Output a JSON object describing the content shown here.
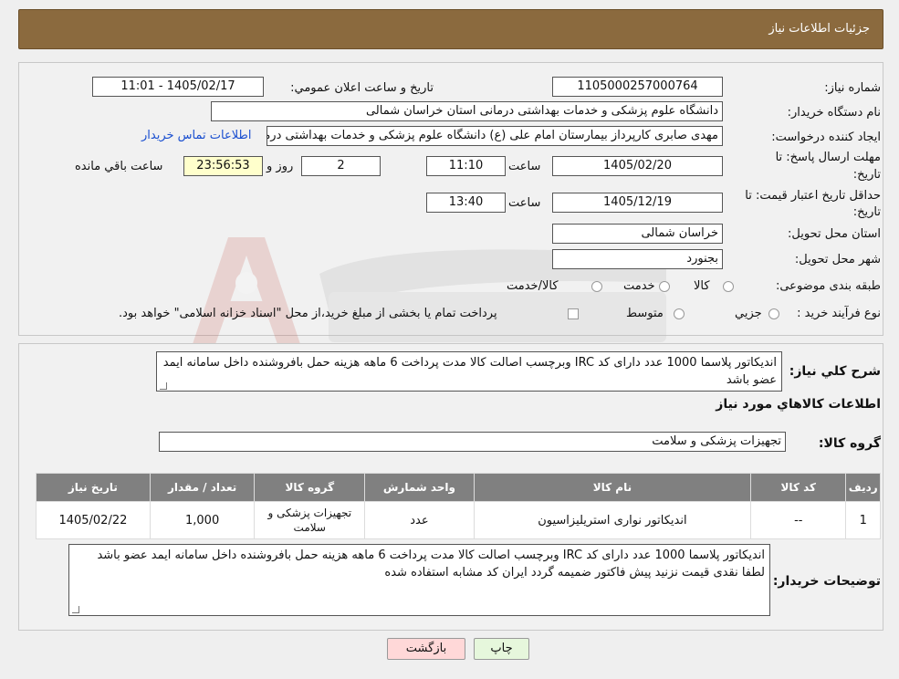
{
  "header": {
    "title": "جزئیات اطلاعات نیاز"
  },
  "info": {
    "need_number_label": "شماره نیاز:",
    "need_number": "1105000257000764",
    "announce_label": "تاریخ و ساعت اعلان عمومي:",
    "announce_value": "1405/02/17 - 11:01",
    "buyer_org_label": "نام دستگاه خريدار:",
    "buyer_org": "دانشگاه علوم پزشکی و خدمات بهداشتی درمانی استان خراسان شمالی",
    "creator_label": "ايجاد کننده درخواست:",
    "creator": "مهدی صابری کارپرداز بیمارستان امام علی (ع) دانشگاه علوم پزشکی و خدمات بهداشتی درمانی",
    "contact_link": "اطلاعات تماس خريدار",
    "deadline_label_1": "مهلت ارسال پاسخ: تا",
    "deadline_label_2": "تاريخ:",
    "deadline_date": "1405/02/20",
    "time_label": "ساعت",
    "deadline_time": "11:10",
    "days_value": "2",
    "days_label": "روز و",
    "remaining_value": "23:56:53",
    "remaining_label": "ساعت باقي مانده",
    "validity_label_1": "حداقل تاريخ اعتبار قيمت: تا",
    "validity_label_2": "تاريخ:",
    "validity_date": "1405/12/19",
    "validity_time": "13:40",
    "province_label": "استان محل تحويل:",
    "province": "خراسان شمالی",
    "city_label": "شهر محل تحويل:",
    "city": "بجنورد",
    "category_label": "طبقه بندی موضوعی:",
    "category_options": [
      "کالا",
      "خدمت",
      "کالا/خدمت"
    ],
    "purchase_type_label": "نوع فرآيند خريد :",
    "purchase_type_options": [
      "جزيي",
      "متوسط"
    ],
    "purchase_type_note": "پرداخت تمام يا بخشی از مبلغ خريد،از محل \"اسناد خزانه اسلامی\" خواهد بود."
  },
  "description": {
    "label": "شرح کلي نياز:",
    "text": "اندیکاتور پلاسما 1000 عدد دارای کد IRC وبرچسب اصالت  کالا مدت پرداخت 6 ماهه هزینه حمل بافروشنده داخل سامانه ایمد عضو باشد"
  },
  "goods": {
    "section_title": "اطلاعات کالاهاي مورد نياز",
    "group_label": "گروه کالا:",
    "group_value": "تجهیزات پزشکی و سلامت",
    "columns": [
      "رديف",
      "کد کالا",
      "نام کالا",
      "واحد شمارش",
      "گروه کالا",
      "تعداد / مقدار",
      "تاريخ نياز"
    ],
    "rows": [
      [
        "1",
        "--",
        "اندیکاتور نواری استریلیزاسیون",
        "عدد",
        "تجهیزات پزشکی و سلامت",
        "1,000",
        "1405/02/22"
      ]
    ]
  },
  "buyer_notes": {
    "label": "توضيحات خريدار:",
    "text": "اندیکاتور پلاسما 1000 عدد دارای کد IRC وبرچسب اصالت  کالا مدت پرداخت 6 ماهه هزینه حمل بافروشنده داخل سامانه ایمد عضو باشد لطفا نقدی قیمت نزنید  پیش فاکتور ضمیمه گردد ایران کد مشابه استفاده شده"
  },
  "buttons": {
    "print": "چاپ",
    "back": "بازگشت"
  },
  "colors": {
    "header": "#8b6a3e",
    "table_header": "#808080",
    "link": "#1a4fd0",
    "remaining_bg": "#ffffcc",
    "back_bg": "#ffd8d8",
    "print_bg": "#e6f7dc"
  }
}
